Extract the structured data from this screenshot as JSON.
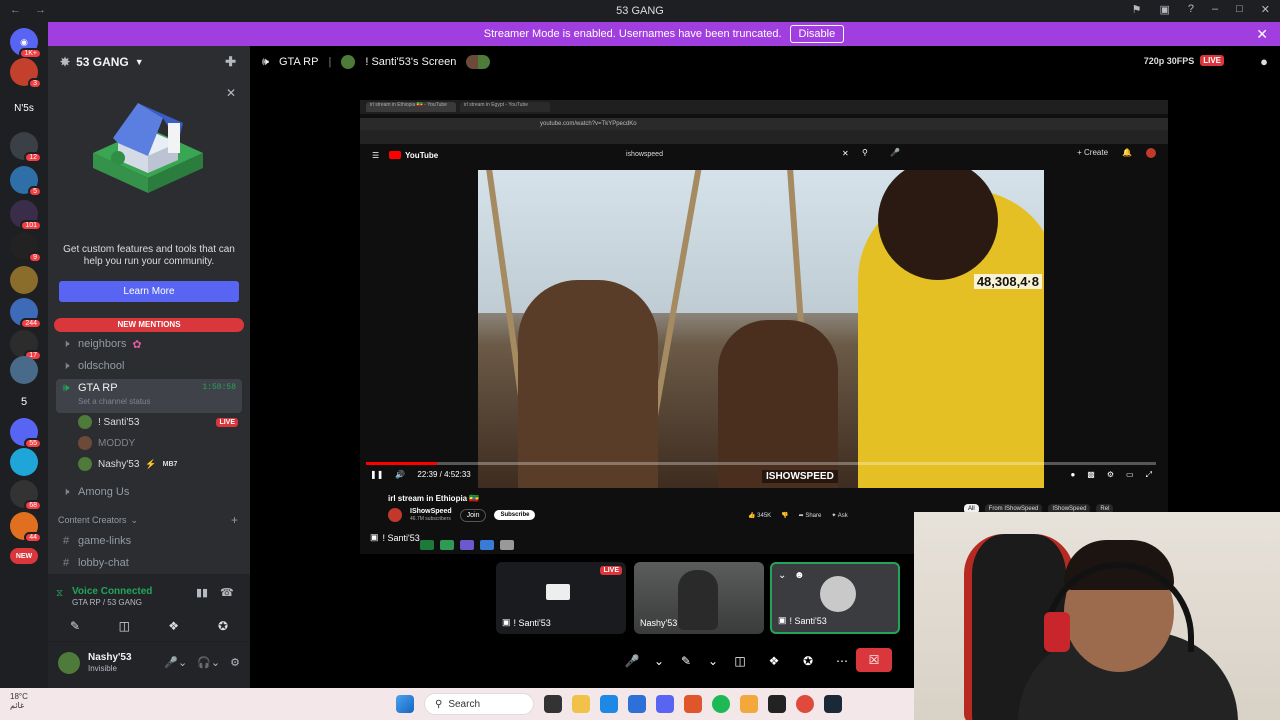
{
  "titlebar": {
    "title": "53 GANG"
  },
  "notice": {
    "text": "Streamer Mode is enabled. Usernames have been truncated.",
    "button": "Disable"
  },
  "rail": {
    "badges": [
      "1K+",
      "3",
      "N'5s",
      "12",
      "5",
      "101",
      "9",
      "244",
      "17",
      "5",
      "55",
      "68",
      "44",
      "NEW"
    ]
  },
  "server": {
    "name": "53 GANG"
  },
  "promo": {
    "text": "Get custom features and tools that can help you run your community.",
    "button": "Learn More"
  },
  "mentions": "NEW MENTIONS",
  "channels": {
    "neighbors": "neighbors",
    "oldschool": "oldschool",
    "gtarp": "GTA RP",
    "gtarp_time": "1:50:58",
    "gtarp_status": "Set a channel status",
    "among_us": "Among Us",
    "category": "Content Creators",
    "game_links": "game-links",
    "lobby_chat": "lobby-chat"
  },
  "members": [
    {
      "name": "! Santi'53",
      "live": "LIVE"
    },
    {
      "name": "MODDY",
      "live": ""
    },
    {
      "name": "Nashy'53",
      "tag": "MB7"
    }
  ],
  "voice": {
    "status": "Voice Connected",
    "where": "GTA RP / 53 GANG"
  },
  "user": {
    "name": "Nashy'53",
    "status": "Invisible"
  },
  "stage": {
    "channel": "GTA RP",
    "screen": "! Santi'53's Screen",
    "quality": "720p 30FPS",
    "live": "LIVE"
  },
  "share": {
    "tab1": "irl stream in Ethiopia 🇪🇹 - YouTube",
    "tab2": "irl stream in Egypt - YouTube",
    "url": "youtube.com/watch?v=TkYPpecdKo",
    "yt_brand": "YouTube",
    "query": "ishowspeed",
    "create": "+ Create",
    "viewers": "48,308,4·8",
    "watermark": "ISHOWSPEED",
    "time": "22:39 / 4:52:33",
    "video_title": "irl stream in Ethiopia 🇪🇹",
    "channel": "IShowSpeed",
    "subs": "46.7M subscribers",
    "join": "Join",
    "subscribe": "Subscribe",
    "likes": "345K",
    "share_btn": "Share",
    "ask": "Ask",
    "chips": [
      "All",
      "From IShowSpeed",
      "IShowSpeed",
      "Rel"
    ],
    "progress": 0.09,
    "label": "! Santi'53"
  },
  "tiles": [
    {
      "name": "! Santi'53",
      "live": "LIVE"
    },
    {
      "name": "Nashy'53"
    },
    {
      "name": "! Santi'53"
    }
  ],
  "taskbar": {
    "temp": "18°C",
    "weather": "غائم",
    "search": "Search"
  }
}
